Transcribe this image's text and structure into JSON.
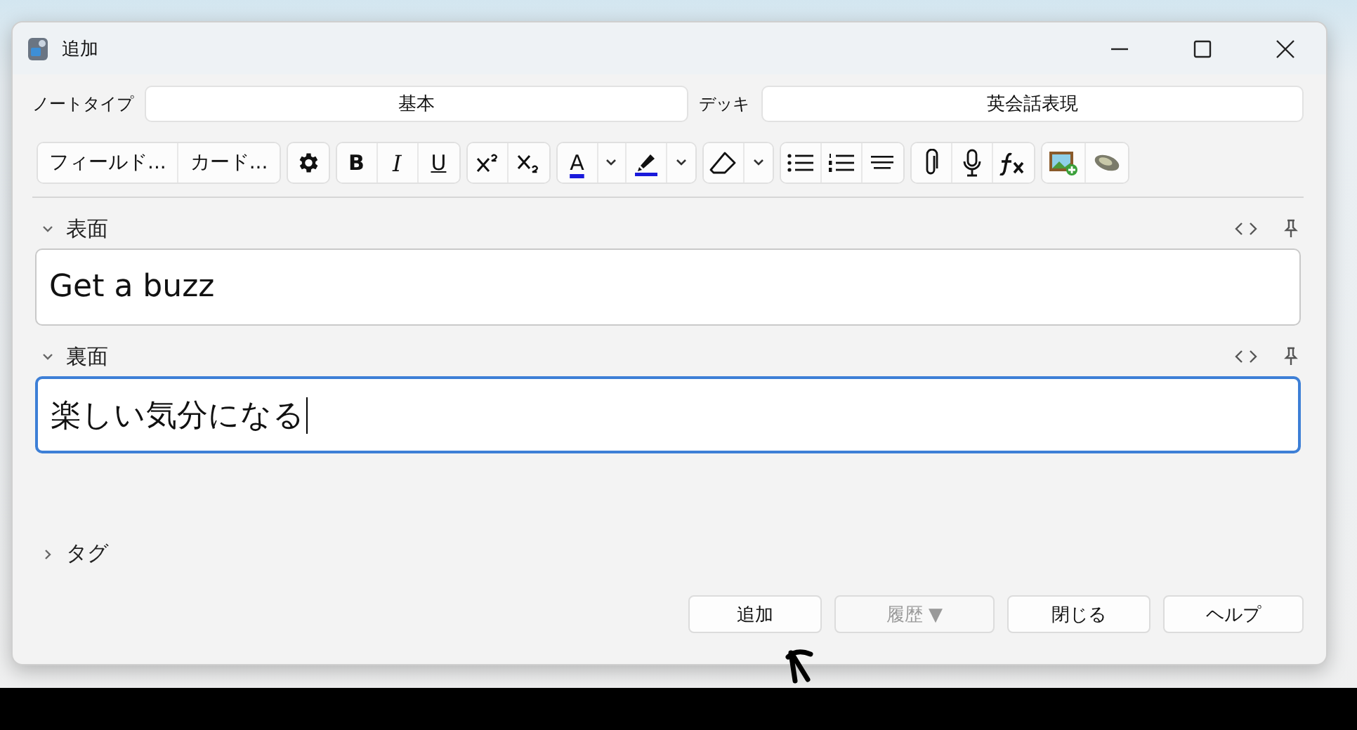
{
  "window": {
    "title": "追加"
  },
  "note_type": {
    "label": "ノートタイプ",
    "value": "基本"
  },
  "deck": {
    "label": "デッキ",
    "value": "英会話表現"
  },
  "toolbar": {
    "fields_button": "フィールド...",
    "cards_button": "カード...",
    "bold": "B",
    "italic": "I",
    "underline": "U",
    "text_color": "A"
  },
  "fields": [
    {
      "label": "表面",
      "value": "Get a buzz",
      "expanded": true,
      "focused": false
    },
    {
      "label": "裏面",
      "value": "楽しい気分になる",
      "expanded": true,
      "focused": true
    }
  ],
  "tags": {
    "label": "タグ",
    "expanded": false
  },
  "buttons": [
    {
      "label": "追加",
      "disabled": false
    },
    {
      "label": "履歴 ▼",
      "disabled": true
    },
    {
      "label": "閉じる",
      "disabled": false
    },
    {
      "label": "ヘルプ",
      "disabled": false
    }
  ]
}
